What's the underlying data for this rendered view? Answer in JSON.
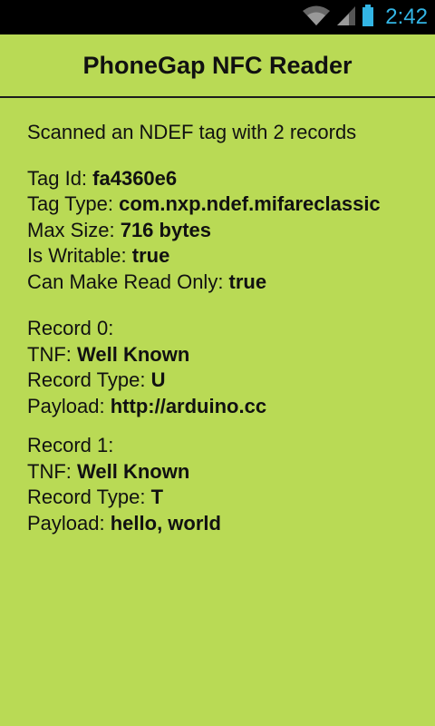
{
  "status_bar": {
    "time": "2:42",
    "icons": [
      "wifi-icon",
      "signal-icon",
      "battery-icon"
    ],
    "accent_color": "#33b5e5"
  },
  "header": {
    "title": "PhoneGap NFC Reader"
  },
  "colors": {
    "background": "#b9da55",
    "text": "#111111"
  },
  "message": "Scanned an NDEF tag with 2 records",
  "tag": {
    "id_label": "Tag Id: ",
    "id_value": "fa4360e6",
    "type_label": "Tag Type: ",
    "type_value": "com.nxp.ndef.mifareclassic",
    "max_size_label": "Max Size: ",
    "max_size_value": "716 bytes",
    "writable_label": "Is Writable: ",
    "writable_value": "true",
    "read_only_label": "Can Make Read Only: ",
    "read_only_value": "true"
  },
  "records": [
    {
      "heading": "Record 0:",
      "tnf_label": "TNF: ",
      "tnf_value": "Well Known",
      "type_label": "Record Type: ",
      "type_value": "U",
      "payload_label": "Payload: ",
      "payload_value": "http://arduino.cc"
    },
    {
      "heading": "Record 1:",
      "tnf_label": "TNF: ",
      "tnf_value": "Well Known",
      "type_label": "Record Type: ",
      "type_value": "T",
      "payload_label": "Payload: ",
      "payload_value": "hello, world"
    }
  ]
}
